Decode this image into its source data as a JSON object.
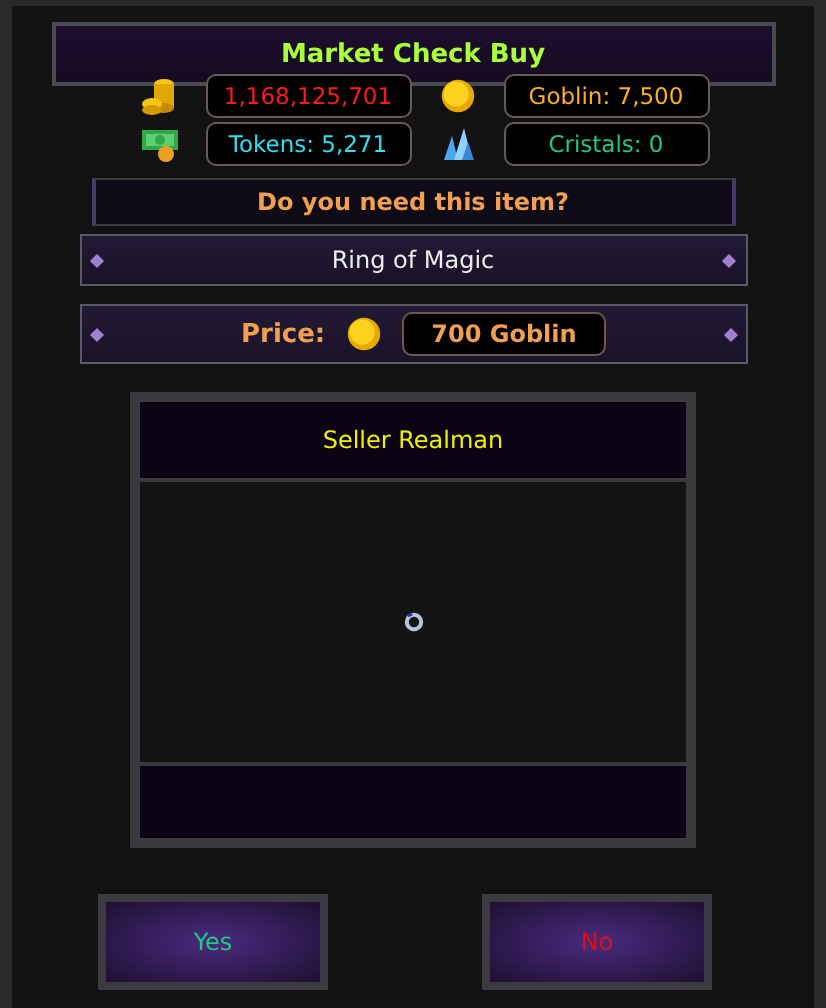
{
  "window": {
    "title": "Market Check Buy"
  },
  "currencies": [
    {
      "kind": "gold",
      "value": "1,168,125,701",
      "color": "#ff1a1a"
    },
    {
      "kind": "coin",
      "value": "Goblin: 7,500",
      "color": "#ffb020"
    },
    {
      "kind": "cash",
      "value": "Tokens: 5,271",
      "color": "#30e0f0"
    },
    {
      "kind": "crystal",
      "value": "Cristals: 0",
      "color": "#20c880"
    }
  ],
  "question": "Do you need this item?",
  "item": {
    "name": "Ring of Magic",
    "price_label": "Price:",
    "price": "700 Goblin",
    "seller": "Seller Realman"
  },
  "buttons": [
    {
      "label": "Yes",
      "kind": "confirm"
    },
    {
      "label": "No",
      "kind": "cancel"
    }
  ]
}
